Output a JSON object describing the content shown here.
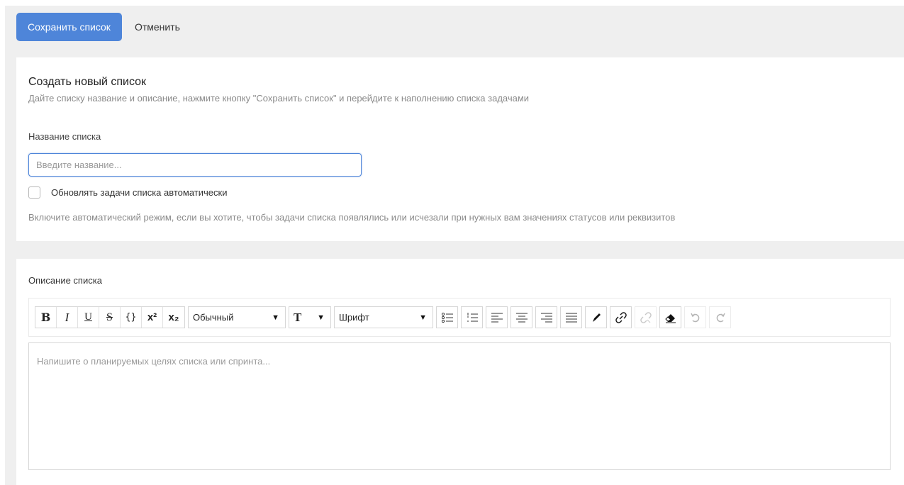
{
  "header": {
    "save_label": "Сохранить список",
    "cancel_label": "Отменить"
  },
  "create": {
    "title": "Создать новый список",
    "subtitle": "Дайте списку название и описание, нажмите кнопку \"Сохранить список\" и перейдите к наполнению списка задачами",
    "name_label": "Название списка",
    "name_value": "",
    "name_placeholder": "Введите название...",
    "auto_update_label": "Обновлять задачи списка автоматически",
    "auto_update_checked": false,
    "hint": "Включите автоматический режим, если вы хотите, чтобы задачи списка появлялись или исчезали при нужных вам значениях статусов или реквизитов"
  },
  "description": {
    "label": "Описание списка",
    "placeholder": "Напишите о планируемых целях списка или спринта...",
    "toolbar": {
      "bold": "B",
      "italic": "I",
      "underline": "U",
      "strike": "S",
      "code": "{}",
      "superscript": "x²",
      "subscript": "x₂",
      "block_type": "Обычный",
      "font_size_icon": "T",
      "font_family": "Шрифт"
    }
  },
  "colors": {
    "accent": "#4e85d9",
    "page_bg": "#efefef"
  }
}
